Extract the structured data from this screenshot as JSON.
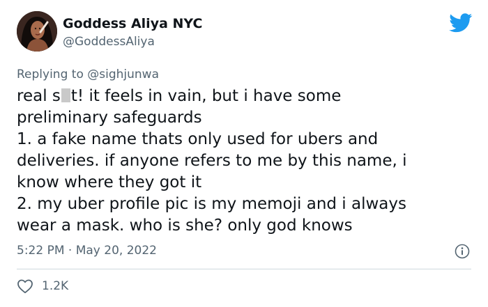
{
  "tweet": {
    "display_name": "Goddess Aliya NYC",
    "handle": "@GoddessAliya",
    "replying_prefix": "Replying to",
    "replying_to": "@sighjunwa",
    "text_lines": [
      {
        "before": "real s",
        "after": "t! it feels in vain, but i have some"
      },
      "preliminary safeguards",
      "1. a fake name thats only used for ubers and",
      "deliveries. if anyone refers to me by this name, i",
      "know where they got it",
      "2. my uber profile pic is my memoji and i always",
      "wear a mask. who is she? only god knows"
    ],
    "time": "5:22 PM",
    "separator": "·",
    "date": "May 20, 2022",
    "like_count": "1.2K"
  },
  "icons": {
    "brand": "twitter-bird-icon",
    "info": "info-icon",
    "like": "heart-icon"
  },
  "colors": {
    "text": "#0f1419",
    "secondary": "#536471",
    "brand": "#1d9bf0",
    "divider": "#cfd9de",
    "censor": "#c9c9c9"
  }
}
